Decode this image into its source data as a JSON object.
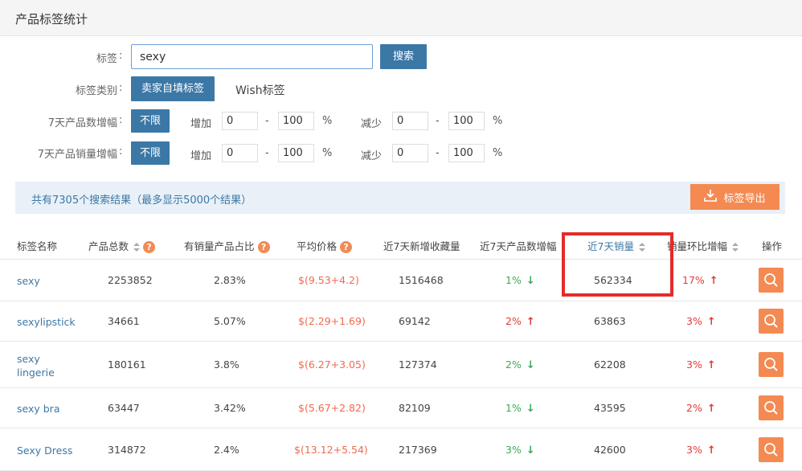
{
  "page": {
    "title": "产品标签统计"
  },
  "filters": {
    "tag_label": "标签",
    "colon": ":",
    "search_value": "sexy",
    "search_button": "搜索",
    "tag_type_label": "标签类别",
    "tag_type_options": [
      "卖家自填标签",
      "Wish标签"
    ],
    "product_growth_label": "7天产品数增幅",
    "sales_growth_label": "7天产品销量增幅",
    "unlimited": "不限",
    "increase": "增加",
    "decrease": "减少",
    "dash": "-",
    "percent": "%",
    "min": "0",
    "max": "100"
  },
  "results": {
    "summary": "共有7305个搜索结果（最多显示5000个结果）",
    "export_button": "标签导出"
  },
  "table": {
    "headers": {
      "name": "标签名称",
      "total": "产品总数",
      "ratio": "有销量产品占比",
      "price": "平均价格",
      "favorites": "近7天新增收藏量",
      "growth": "近7天产品数增幅",
      "sales": "近7天销量",
      "sales_growth": "销量环比增幅",
      "action": "操作"
    },
    "rows": [
      {
        "name": "sexy",
        "total": "2253852",
        "ratio": "2.83%",
        "price": "$(9.53+4.2)",
        "favorites": "1516468",
        "growth": "1%",
        "growth_dir": "down",
        "sales": "562334",
        "sales_growth": "17%",
        "sales_dir": "up"
      },
      {
        "name": "sexylipstick",
        "total": "34661",
        "ratio": "5.07%",
        "price": "$(2.29+1.69)",
        "favorites": "69142",
        "growth": "2%",
        "growth_dir": "up",
        "sales": "63863",
        "sales_growth": "3%",
        "sales_dir": "up"
      },
      {
        "name": "sexy lingerie",
        "total": "180161",
        "ratio": "3.8%",
        "price": "$(6.27+3.05)",
        "favorites": "127374",
        "growth": "2%",
        "growth_dir": "down",
        "sales": "62208",
        "sales_growth": "3%",
        "sales_dir": "up"
      },
      {
        "name": "sexy bra",
        "total": "63447",
        "ratio": "3.42%",
        "price": "$(5.67+2.82)",
        "favorites": "82109",
        "growth": "1%",
        "growth_dir": "down",
        "sales": "43595",
        "sales_growth": "2%",
        "sales_dir": "up"
      },
      {
        "name": "Sexy Dress",
        "total": "314872",
        "ratio": "2.4%",
        "price": "$(13.12+5.54)",
        "favorites": "217369",
        "growth": "3%",
        "growth_dir": "down",
        "sales": "42600",
        "sales_growth": "3%",
        "sales_dir": "up"
      }
    ]
  },
  "icons": {
    "sort": "sort-icon",
    "help": "help-icon",
    "download": "download-icon",
    "search": "search-icon",
    "arrow_up": "arrow-up-icon",
    "arrow_down": "arrow-down-icon"
  },
  "colors": {
    "primary": "#3c78a6",
    "accent": "#f48a52",
    "up": "#e53935",
    "down": "#3aaa56",
    "highlight": "#e52b2b"
  }
}
